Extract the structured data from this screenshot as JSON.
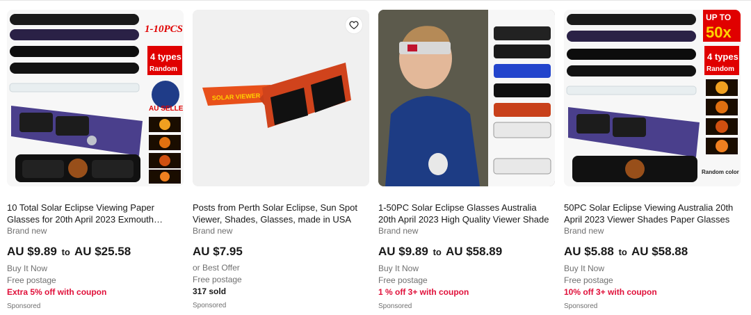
{
  "listings": [
    {
      "image_text": {
        "qty": "1-10PCS",
        "types": "4 types",
        "random": "Random",
        "seller": "AU SELLER"
      },
      "title": "10 Total Solar Eclipse Viewing Paper Glasses for 20th April 2023 Exmouth…",
      "condition": "Brand new",
      "price_low": "AU $9.89",
      "price_to": "to",
      "price_high": "AU $25.58",
      "buy": "Buy It Now",
      "postage": "Free postage",
      "promo": "Extra 5% off with coupon",
      "sponsored": "Sponsored"
    },
    {
      "image_text": {
        "glasses": "SOLAR VIEWER"
      },
      "title": "Posts from Perth Solar Eclipse, Sun Spot Viewer, Shades, Glasses, made in USA",
      "condition": "Brand new",
      "price": "AU $7.95",
      "offer": "or Best Offer",
      "postage": "Free postage",
      "sold": "317 sold",
      "sponsored": "Sponsored"
    },
    {
      "title": "1-50PC Solar Eclipse Glasses Australia 20th April 2023 High Quality Viewer Shade",
      "condition": "Brand new",
      "price_low": "AU $9.89",
      "price_to": "to",
      "price_high": "AU $58.89",
      "buy": "Buy It Now",
      "postage": "Free postage",
      "promo": "1 % off 3+ with coupon",
      "sponsored": "Sponsored"
    },
    {
      "image_text": {
        "up_to": "UP TO",
        "qty": "50x",
        "types": "4 types",
        "random": "Random",
        "random_color": "Random color"
      },
      "title": "50PC Solar Eclipse Viewing Australia 20th April 2023 Viewer Shades Paper Glasses",
      "condition": "Brand new",
      "price_low": "AU $5.88",
      "price_to": "to",
      "price_high": "AU $58.88",
      "buy": "Buy It Now",
      "postage": "Free postage",
      "promo": "10% off 3+ with coupon",
      "sponsored": "Sponsored"
    }
  ],
  "colors": {
    "promo": "#e0103a",
    "muted": "#707070",
    "text": "#191919"
  },
  "icons": {
    "favorite": "heart-icon"
  }
}
